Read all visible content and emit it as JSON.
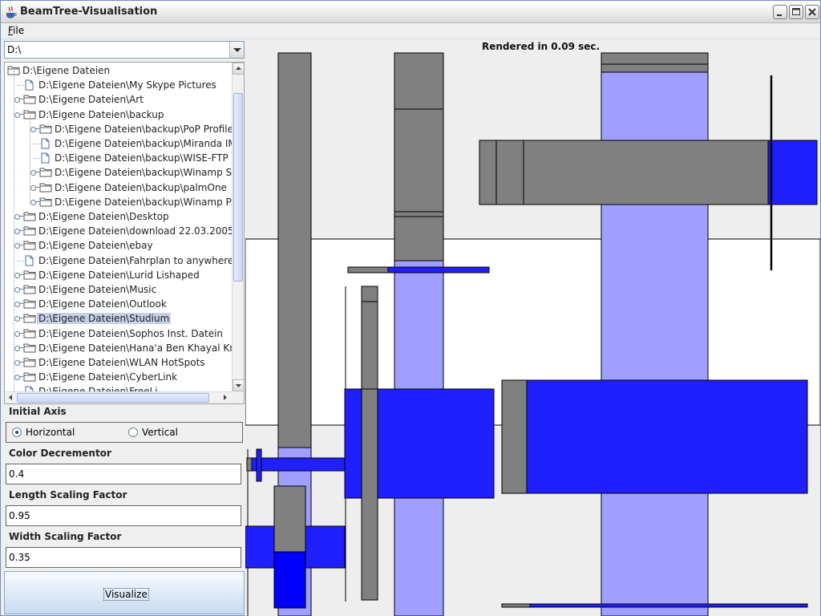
{
  "window": {
    "title": "BeamTree-Visualisation"
  },
  "menu": {
    "file": "File"
  },
  "drive": {
    "value": "D:\\"
  },
  "tree": {
    "items": [
      {
        "label": "D:\\Eigene Dateien",
        "level": 0,
        "type": "folder",
        "handle": false
      },
      {
        "label": "D:\\Eigene Dateien\\My Skype Pictures",
        "level": 1,
        "type": "file",
        "handle": false
      },
      {
        "label": "D:\\Eigene Dateien\\Art",
        "level": 1,
        "type": "folder",
        "handle": true
      },
      {
        "label": "D:\\Eigene Dateien\\backup",
        "level": 1,
        "type": "folder",
        "handle": true
      },
      {
        "label": "D:\\Eigene Dateien\\backup\\PoP Profiles",
        "level": 2,
        "type": "folder",
        "handle": true
      },
      {
        "label": "D:\\Eigene Dateien\\backup\\Miranda IM",
        "level": 2,
        "type": "file",
        "handle": false
      },
      {
        "label": "D:\\Eigene Dateien\\backup\\WISE-FTP",
        "level": 2,
        "type": "file",
        "handle": false
      },
      {
        "label": "D:\\Eigene Dateien\\backup\\Winamp Skins",
        "level": 2,
        "type": "folder",
        "handle": true
      },
      {
        "label": "D:\\Eigene Dateien\\backup\\palmOne",
        "level": 2,
        "type": "folder",
        "handle": true
      },
      {
        "label": "D:\\Eigene Dateien\\backup\\Winamp Plugi",
        "level": 2,
        "type": "folder",
        "handle": true
      },
      {
        "label": "D:\\Eigene Dateien\\Desktop",
        "level": 1,
        "type": "folder",
        "handle": true
      },
      {
        "label": "D:\\Eigene Dateien\\download 22.03.2005",
        "level": 1,
        "type": "folder",
        "handle": true
      },
      {
        "label": "D:\\Eigene Dateien\\ebay",
        "level": 1,
        "type": "folder",
        "handle": true
      },
      {
        "label": "D:\\Eigene Dateien\\Fahrplan to anywhere",
        "level": 1,
        "type": "file",
        "handle": false
      },
      {
        "label": "D:\\Eigene Dateien\\Lurid Lishaped",
        "level": 1,
        "type": "folder",
        "handle": true
      },
      {
        "label": "D:\\Eigene Dateien\\Music",
        "level": 1,
        "type": "folder",
        "handle": true
      },
      {
        "label": "D:\\Eigene Dateien\\Outlook",
        "level": 1,
        "type": "folder",
        "handle": true
      },
      {
        "label": "D:\\Eigene Dateien\\Studium",
        "level": 1,
        "type": "folder",
        "handle": true,
        "selected": true
      },
      {
        "label": "D:\\Eigene Dateien\\Sophos Inst. Datein",
        "level": 1,
        "type": "folder",
        "handle": true
      },
      {
        "label": "D:\\Eigene Dateien\\Hana'a Ben Khayal KnoKi",
        "level": 1,
        "type": "folder",
        "handle": true
      },
      {
        "label": "D:\\Eigene Dateien\\WLAN HotSpots",
        "level": 1,
        "type": "folder",
        "handle": true
      },
      {
        "label": "D:\\Eigene Dateien\\CyberLink",
        "level": 1,
        "type": "folder",
        "handle": true
      },
      {
        "label": "D:\\Eigene Dateien\\FreeLi...",
        "level": 1,
        "type": "file",
        "handle": false
      }
    ]
  },
  "settings": {
    "initial_axis": {
      "title": "Initial Axis",
      "options": [
        "Horizontal",
        "Vertical"
      ],
      "selected": "Horizontal"
    },
    "color_decrementor": {
      "title": "Color Decrementor",
      "value": "0.4"
    },
    "length_scaling": {
      "title": "Length Scaling Factor",
      "value": "0.95"
    },
    "width_scaling": {
      "title": "Width Scaling Factor",
      "value": "0.35"
    },
    "visualize_label": "Visualize"
  },
  "canvas": {
    "status": "Rendered in 0.09 sec.",
    "colors": {
      "gray": "#808080",
      "blue": "#1f1fff",
      "light_blue": "#9f9fff",
      "white": "#ffffff",
      "black": "#000000"
    }
  }
}
